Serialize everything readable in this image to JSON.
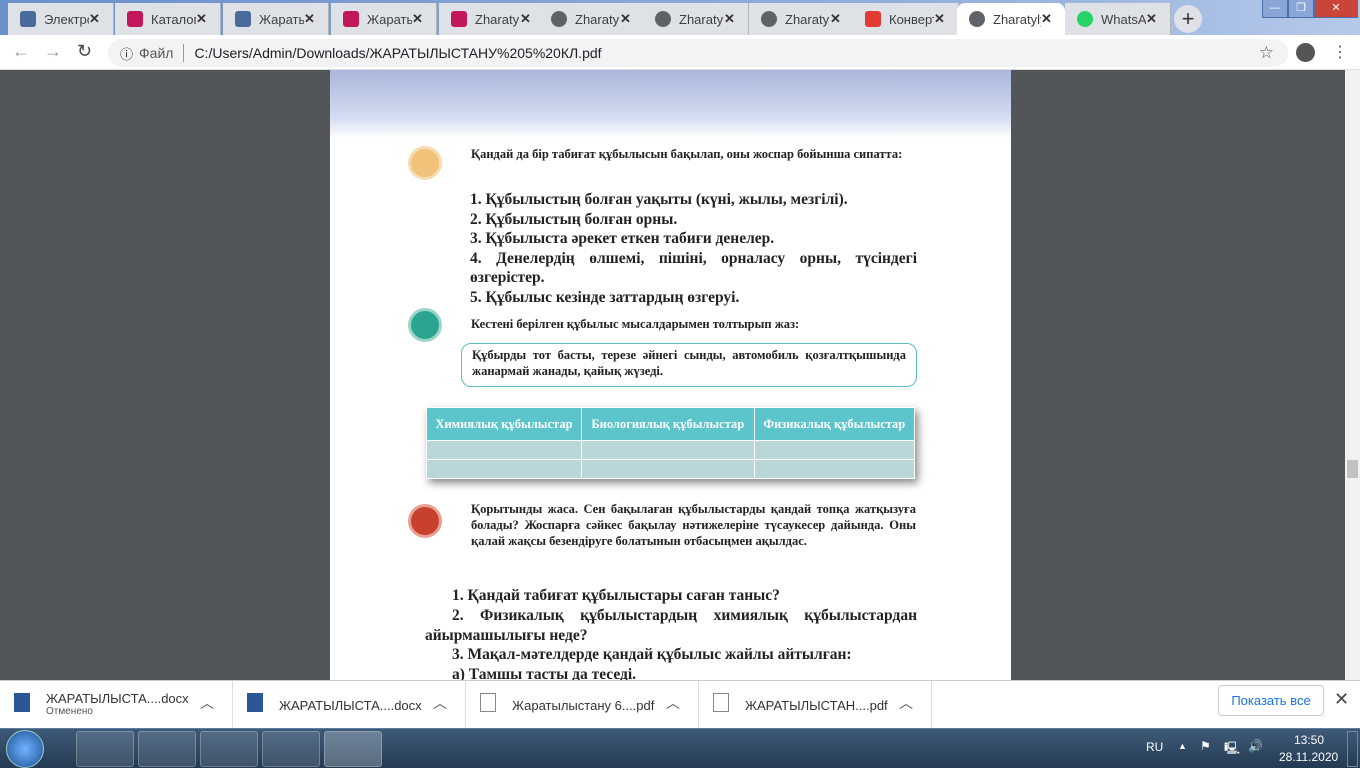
{
  "browser": {
    "tabs": [
      {
        "label": "Электронный",
        "icon": "books-icon"
      },
      {
        "label": "Каталог",
        "icon": "book-icon"
      },
      {
        "label": "Жаратылыстану",
        "icon": "books-icon"
      },
      {
        "label": "Жаратылыстану",
        "icon": "book-icon"
      },
      {
        "label": "Zharatylystanu",
        "icon": "book-icon"
      },
      {
        "label": "Zharatylystanu",
        "icon": "globe-icon"
      },
      {
        "label": "Zharatylystanu",
        "icon": "globe-icon"
      },
      {
        "label": "Zharatylystanu",
        "icon": "globe-icon"
      },
      {
        "label": "Конвертер",
        "icon": "heart-icon"
      },
      {
        "label": "Zharatylystanu",
        "icon": "globe-icon",
        "active": true
      },
      {
        "label": "WhatsApp",
        "icon": "whatsapp-icon"
      }
    ],
    "address": {
      "scheme_label": "Файл",
      "url": "C:/Users/Admin/Downloads/ЖАРАТЫЛЫСТАНУ%205%20КЛ.pdf"
    }
  },
  "document": {
    "task1": {
      "intro": "Қандай да бір табиғат құбылысын бақылап, оны жоспар бойынша сипатта:",
      "items": [
        "1. Құбылыстың болған уақыты (күні, жылы, мезгілі).",
        "2. Құбылыстың болған орны.",
        "3. Құбылыста әрекет еткен табиғи денелер.",
        "4. Денелердің өлшемі, пішіні, орналасу орны, түсіндегі өзгерістер.",
        "5. Құбылыс кезінде заттардың өзгеруі."
      ]
    },
    "task2": {
      "intro": "Кестені берілген құбылыс мысалдарымен толтырып жаз:",
      "box": "Құбырды тот басты, терезе әйнегі сынды, автомобиль қозғалтқышында жанармай жанады, қайық жүзеді.",
      "headers": [
        "Химиялық құбылыстар",
        "Биологиялық құбылыстар",
        "Физикалық құбылыстар"
      ]
    },
    "task3": {
      "bold": "Қорытынды жаса.",
      "text": " Сен бақылаған құбылыстарды қандай топқа жатқызуға болады? Жоспарға сәйкес бақылау нәтижелеріне түсаукесер дайында. Оны қалай жақсы безендіруге болатынын отбасыңмен ақылдас."
    },
    "questions": [
      "1. Қандай табиғат құбылыстары саған таныс?",
      "2. Физикалық құбылыстардың химиялық құбылыстардан айырмашылығы неде?",
      "3. Мақал-мәтелдерде қандай құбылыс жайлы айтылған:",
      "а) Тамшы тасты да теседі."
    ]
  },
  "downloads": {
    "items": [
      {
        "name": "ЖАРАТЫЛЫСТА....docx",
        "status": "Отменено",
        "type": "word"
      },
      {
        "name": "ЖАРАТЫЛЫСТА....docx",
        "type": "word"
      },
      {
        "name": "Жаратылыстану 6....pdf",
        "type": "file"
      },
      {
        "name": "ЖАРАТЫЛЫСТАН....pdf",
        "type": "file"
      }
    ],
    "show_all": "Показать все"
  },
  "taskbar": {
    "lang": "RU",
    "time": "13:50",
    "date": "28.11.2020"
  }
}
